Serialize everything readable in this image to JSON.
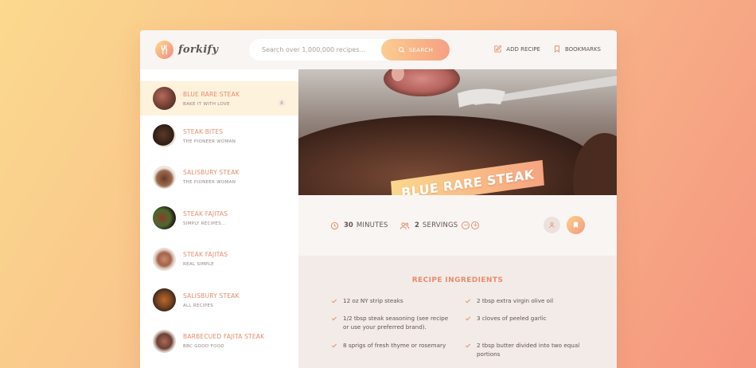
{
  "app": {
    "logo_text": "forkify"
  },
  "search": {
    "placeholder": "Search over 1,000,000 recipes...",
    "button_label": "SEARCH"
  },
  "nav": {
    "add_recipe": "ADD RECIPE",
    "bookmarks": "BOOKMARKS"
  },
  "results": [
    {
      "title": "BLUE RARE STEAK",
      "publisher": "BAKE IT WITH LOVE",
      "active": true,
      "user_generated": true
    },
    {
      "title": "STEAK BITES",
      "publisher": "THE PIONEER WOMAN"
    },
    {
      "title": "SALISBURY STEAK",
      "publisher": "THE PIONEER WOMAN"
    },
    {
      "title": "STEAK FAJITAS",
      "publisher": "SIMPLY RECIPES..."
    },
    {
      "title": "STEAK FAJITAS",
      "publisher": "REAL SIMPLE"
    },
    {
      "title": "SALISBURY STEAK",
      "publisher": "ALL RECIPES"
    },
    {
      "title": "BARBECUED FAJITA STEAK",
      "publisher": "BBC GOOD FOOD"
    }
  ],
  "recipe": {
    "title": "BLUE RARE STEAK",
    "minutes": "30",
    "minutes_label": "MINUTES",
    "servings": "2",
    "servings_label": "SERVINGS",
    "ingredients_heading": "RECIPE INGREDIENTS",
    "ingredients": [
      "12 oz NY strip steaks",
      "2 tbsp extra virgin olive oil",
      "1/2 tbsp steak seasoning (see recipe or use your preferred brand).",
      "3 cloves of peeled garlic",
      "8 sprigs of fresh thyme or rosemary",
      "2 tbsp butter divided into two equal portions"
    ]
  },
  "colors": {
    "accent": "#e68c6e",
    "gradient_start": "#fbdb89",
    "gradient_end": "#f48982",
    "text": "#615551"
  }
}
